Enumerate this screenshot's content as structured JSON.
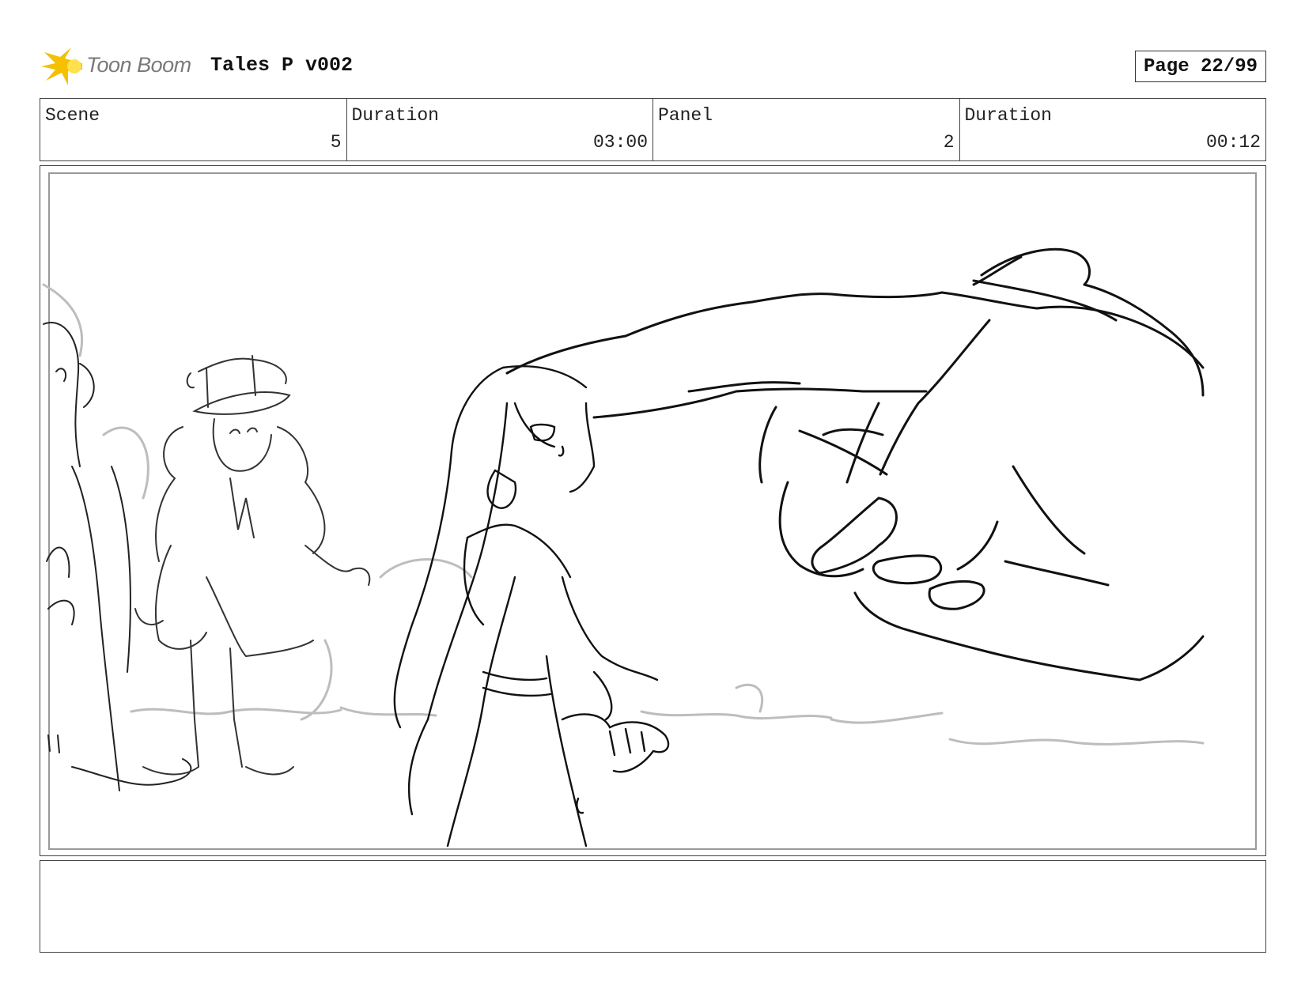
{
  "header": {
    "logo_text": "Toon Boom",
    "title": "Tales P v002",
    "page_label": "Page 22/99"
  },
  "info": {
    "scene_label": "Scene",
    "scene_value": "5",
    "scene_duration_label": "Duration",
    "scene_duration_value": "03:00",
    "panel_label": "Panel",
    "panel_value": "2",
    "panel_duration_label": "Duration",
    "panel_duration_value": "00:12"
  },
  "colors": {
    "logo_yellow": "#f5c000",
    "logo_text": "#7a7a7a",
    "sketch_line": "#111111",
    "rough_line": "#bdbdbd"
  },
  "caption": ""
}
